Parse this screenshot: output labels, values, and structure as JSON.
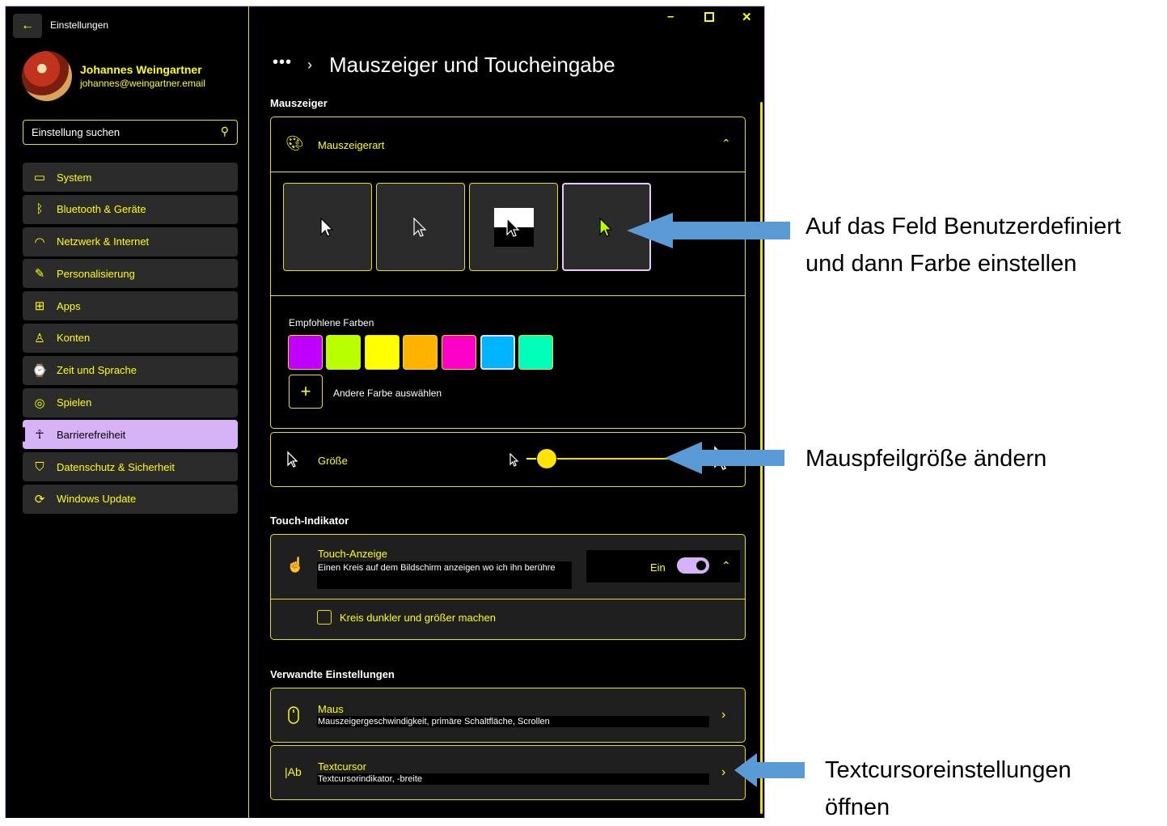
{
  "window": {
    "app_title": "Einstellungen",
    "controls": [
      "minimize",
      "maximize",
      "close"
    ]
  },
  "user": {
    "name": "Johannes Weingartner",
    "email": "johannes@weingartner.email"
  },
  "search": {
    "placeholder": "Einstellung suchen"
  },
  "sidebar": {
    "items": [
      {
        "label": "System",
        "icon": "monitor-icon"
      },
      {
        "label": "Bluetooth & Geräte",
        "icon": "bluetooth-icon"
      },
      {
        "label": "Netzwerk & Internet",
        "icon": "wifi-icon"
      },
      {
        "label": "Personalisierung",
        "icon": "brush-icon"
      },
      {
        "label": "Apps",
        "icon": "apps-icon"
      },
      {
        "label": "Konten",
        "icon": "person-icon"
      },
      {
        "label": "Zeit und Sprache",
        "icon": "time-language-icon"
      },
      {
        "label": "Spielen",
        "icon": "gamepad-icon"
      },
      {
        "label": "Barrierefreiheit",
        "icon": "accessibility-icon",
        "active": true
      },
      {
        "label": "Datenschutz & Sicherheit",
        "icon": "shield-icon"
      },
      {
        "label": "Windows Update",
        "icon": "update-icon"
      }
    ]
  },
  "header": {
    "breadcrumb_more": "•••",
    "title": "Mauszeiger und Toucheingabe"
  },
  "mouse_pointer": {
    "section_label": "Mauszeiger",
    "style_title": "Mauszeigerart",
    "recommended_colors_label": "Empfohlene Farben",
    "swatches": [
      "#c000ff",
      "#b8ff00",
      "#ffff00",
      "#ffb300",
      "#ff00c8",
      "#00b4ff",
      "#00ffb8"
    ],
    "selected_swatch": 5,
    "other_color_label": "Andere Farbe auswählen",
    "size_label": "Größe"
  },
  "touch": {
    "section_label": "Touch-Indikator",
    "title": "Touch-Anzeige",
    "description": "Einen Kreis auf dem Bildschirm anzeigen wo ich ihn berühre",
    "toggle_state": "Ein",
    "checkbox_label": "Kreis dunkler und größer machen"
  },
  "related": {
    "section_label": "Verwandte Einstellungen",
    "items": [
      {
        "title": "Maus",
        "description": "Mauszeigergeschwindigkeit, primäre Schaltfläche, Scrollen"
      },
      {
        "title": "Textcursor",
        "description": "Textcursorindikator, -breite"
      }
    ]
  },
  "annotations": {
    "pointer_color": [
      "Auf das Feld Benutzerdefiniert",
      "und dann Farbe einstellen"
    ],
    "pointer_size": "Mauspfeilgröße ändern",
    "text_cursor": [
      "Textcursoreinstellungen",
      "öffnen"
    ]
  },
  "colors": {
    "accent": "#ffff00",
    "background": "#000000",
    "active_nav": "#d6b3f7",
    "arrow": "#5b9bd5"
  }
}
